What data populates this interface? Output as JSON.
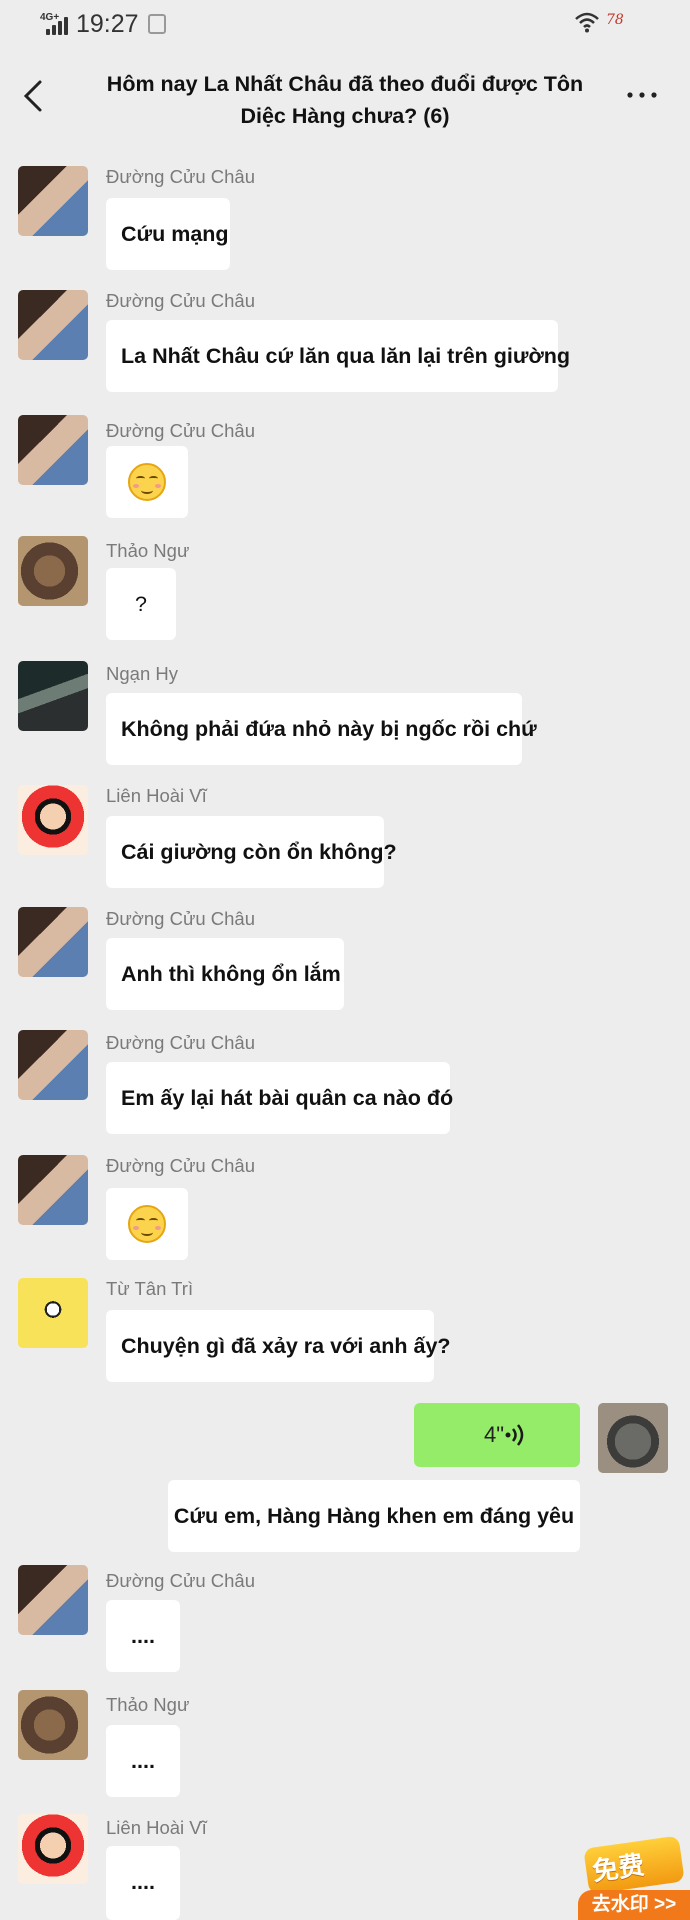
{
  "status_bar": {
    "network": "4G+",
    "time": "19:27",
    "battery_text": "78"
  },
  "header": {
    "title": "Hôm nay La Nhất Châu đã theo đuổi được Tôn Diệc Hàng chưa?  (6)",
    "more_dots": "· · ·"
  },
  "messages": [
    {
      "sender": "Đường Cửu Châu",
      "text": "Cứu mạng"
    },
    {
      "sender": "Đường Cửu Châu",
      "text": "La Nhất Châu cứ lăn qua lăn lại trên giường"
    },
    {
      "sender": "Đường Cửu Châu",
      "emoji": "blushing-grin"
    },
    {
      "sender": "Thảo Ngư",
      "text": "?"
    },
    {
      "sender": "Ngạn Hy",
      "text": "Không phải đứa nhỏ này bị ngốc rồi chứ"
    },
    {
      "sender": "Liên Hoài Vĩ",
      "text": "Cái giường còn ổn không?"
    },
    {
      "sender": "Đường Cửu Châu",
      "text": "Anh thì không ổn lắm"
    },
    {
      "sender": "Đường Cửu Châu",
      "text": "Em ấy lại hát bài quân ca nào đó"
    },
    {
      "sender": "Đường Cửu Châu",
      "emoji": "blushing-grin"
    },
    {
      "sender": "Từ Tân Trì",
      "text": "Chuyện gì đã xảy ra với anh ấy?"
    },
    {
      "sender": "Đường Cửu Châu",
      "text": "...."
    },
    {
      "sender": "Thảo Ngư",
      "text": "...."
    },
    {
      "sender": "Liên Hoài Vĩ",
      "text": "...."
    }
  ],
  "voice_message": {
    "duration": "4\""
  },
  "system_line": "Cứu em, Hàng Hàng khen em đáng yêu",
  "promo": {
    "line1": "免费",
    "line2": "去水印 >>"
  },
  "colors": {
    "background": "#ededed",
    "bubble": "#ffffff",
    "self_bubble": "#95ec69",
    "sender": "#7a7a7a"
  }
}
